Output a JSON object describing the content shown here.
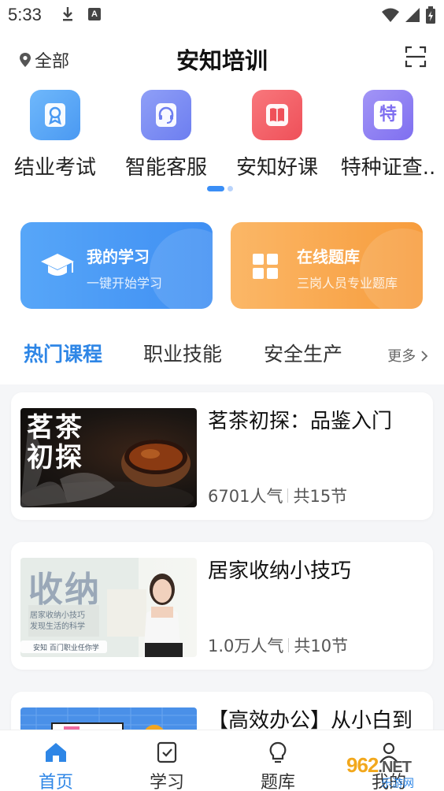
{
  "status_bar": {
    "time": "5:33",
    "a_badge": "A"
  },
  "header": {
    "location": "全部",
    "title": "安知培训"
  },
  "quick_actions": [
    {
      "label": "结业考试",
      "icon": "certificate-icon",
      "color": "#5aa9f5"
    },
    {
      "label": "智能客服",
      "icon": "headset-icon",
      "color": "#7f8ff2"
    },
    {
      "label": "安知好课",
      "icon": "book-icon",
      "color": "#f2626a"
    },
    {
      "label": "特种证查..",
      "icon": "special-cert-icon",
      "icon_text": "特",
      "color": "#8d7ff0"
    }
  ],
  "feature_cards": [
    {
      "title": "我的学习",
      "subtitle": "一键开始学习",
      "icon": "graduation-cap-icon"
    },
    {
      "title": "在线题库",
      "subtitle": "三岗人员专业题库",
      "icon": "grid-icon"
    }
  ],
  "tabs": [
    {
      "label": "热门课程",
      "active": true
    },
    {
      "label": "职业技能",
      "active": false
    },
    {
      "label": "安全生产",
      "active": false
    }
  ],
  "more_label": "更多",
  "courses": [
    {
      "title": "茗茶初探：品鉴入门",
      "popularity": "6701人气",
      "sections": "共15节",
      "thumb_text": "茗茶初探"
    },
    {
      "title": "居家收纳小技巧",
      "popularity": "1.0万人气",
      "sections": "共10节",
      "thumb_text": "收纳",
      "thumb_sub1": "居家收纳小技巧",
      "thumb_sub2": "发现生活的科学",
      "thumb_footer": "安知 百门职业任你学"
    },
    {
      "title": "【高效办公】从小白到",
      "popularity": "",
      "sections": ""
    }
  ],
  "bottom_nav": [
    {
      "label": "首页",
      "icon": "home-icon",
      "active": true
    },
    {
      "label": "学习",
      "icon": "checklist-icon",
      "active": false
    },
    {
      "label": "题库",
      "icon": "lightbulb-icon",
      "active": false
    },
    {
      "label": "我的",
      "icon": "person-icon",
      "active": false
    }
  ],
  "watermark": {
    "brand": "962",
    "domain": ".NET",
    "name": "乐游网"
  },
  "colors": {
    "accent": "#2e86e6",
    "blue_card": "#4a9af5",
    "orange_card": "#f9a94f"
  }
}
